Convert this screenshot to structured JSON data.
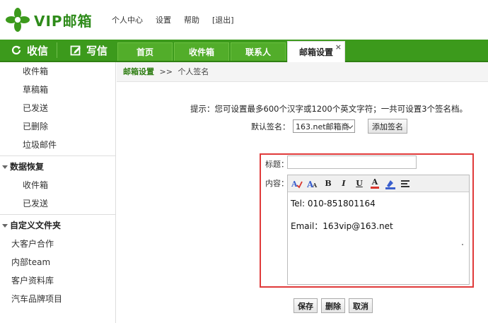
{
  "logo": {
    "text": "VIP邮箱",
    "brand_color": "#2e8b1a"
  },
  "top_links": [
    "个人中心",
    "设置",
    "帮助",
    "[退出]"
  ],
  "nav": {
    "receive": {
      "icon": "refresh-icon",
      "label": "收信"
    },
    "compose": {
      "icon": "compose-icon",
      "label": "写信"
    },
    "bar_color": "#3c9a1c",
    "tabs": [
      {
        "label": "首页"
      },
      {
        "label": "收件箱"
      },
      {
        "label": "联系人"
      },
      {
        "label": "邮箱设置",
        "close": "×",
        "active": true
      }
    ]
  },
  "sidebar": {
    "folders": [
      "收件箱",
      "草稿箱",
      "已发送",
      "已删除",
      "垃圾邮件"
    ],
    "recovery": {
      "title": "数据恢复",
      "items": [
        "收件箱",
        "已发送"
      ]
    },
    "custom": {
      "title": "自定义文件夹",
      "items": [
        "大客户合作",
        "内部team",
        "客户资料库",
        "汽车品牌项目"
      ]
    }
  },
  "breadcrumb": {
    "root": "邮箱设置",
    "sep": ">>",
    "current": "个人签名"
  },
  "hint": "提示：您可设置最多600个汉字或1200个英文字符；一共可设置3个签名档。",
  "default_sig": {
    "label": "默认签名：",
    "value": "163.net邮箱商",
    "add_button": "添加签名"
  },
  "form": {
    "title_label": "标题：",
    "title_value": "",
    "content_label": "内容：",
    "toolbar": [
      {
        "icon": "spellcheck-icon"
      },
      {
        "icon": "font-icon"
      },
      {
        "icon": "bold-icon",
        "text": "B"
      },
      {
        "icon": "italic-icon",
        "text": "I"
      },
      {
        "icon": "underline-icon",
        "text": "U"
      },
      {
        "icon": "text-color-icon",
        "text": "A"
      },
      {
        "icon": "highlight-icon"
      },
      {
        "icon": "align-icon"
      }
    ],
    "content_lines": [
      "Tel: 010-851801164",
      "",
      "Email：163vip@163.net"
    ],
    "highlight_color": "#e03a3a"
  },
  "actions": {
    "save": "保存",
    "delete": "删除",
    "cancel": "取消"
  }
}
